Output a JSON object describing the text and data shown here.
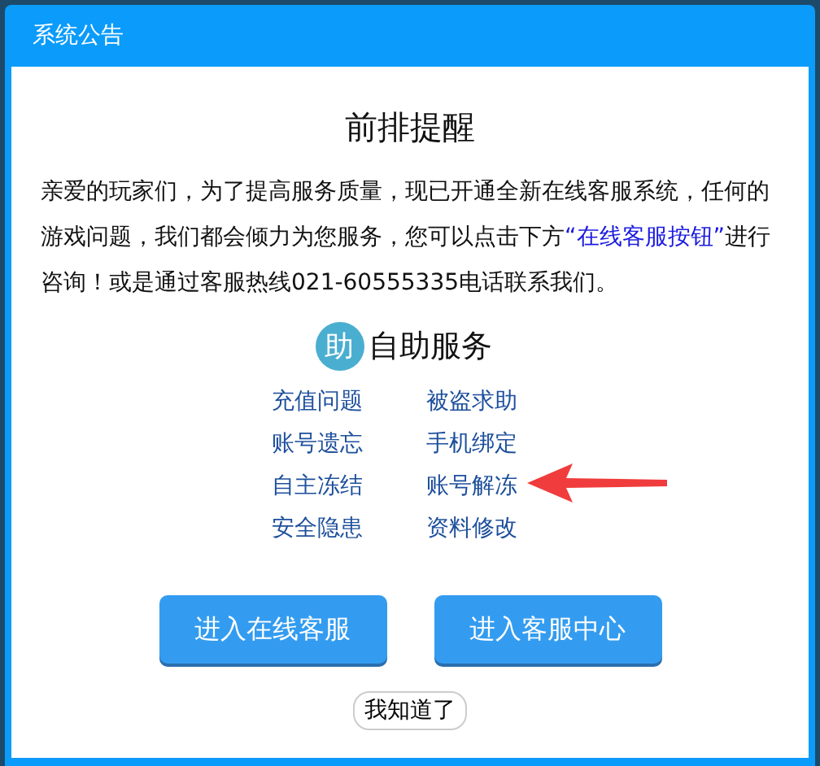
{
  "window": {
    "title": "系统公告"
  },
  "notice": {
    "heading": "前排提醒",
    "paragraph": [
      {
        "kind": "text",
        "text": "亲爱的玩家们，为了提高服务质量，现已开通全新在线客服系统，任何的游戏问题，我们都会倾力为您服务，您可以点击下方"
      },
      {
        "kind": "link",
        "text": "“在线客服按钮”"
      },
      {
        "kind": "text",
        "text": "进行咨询！或是通过客服热线021-60555335电话联系我们。"
      }
    ]
  },
  "self_service": {
    "badge": "助",
    "title": "自助服务",
    "links": [
      {
        "label": "充值问题",
        "highlighted": false
      },
      {
        "label": "被盗求助",
        "highlighted": false
      },
      {
        "label": "账号遗忘",
        "highlighted": false
      },
      {
        "label": "手机绑定",
        "highlighted": false
      },
      {
        "label": "自主冻结",
        "highlighted": false
      },
      {
        "label": "账号解冻",
        "highlighted": true
      },
      {
        "label": "安全隐患",
        "highlighted": false
      },
      {
        "label": "资料修改",
        "highlighted": false
      }
    ]
  },
  "buttons": [
    "进入在线客服",
    "进入客服中心"
  ],
  "dismiss": "我知道了"
}
